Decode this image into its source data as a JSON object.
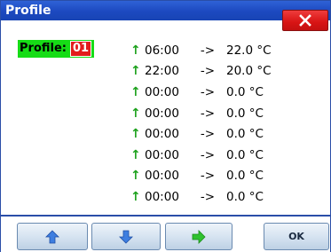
{
  "window": {
    "title": "Profile",
    "close_icon": "close-icon",
    "colors": {
      "titlebar": "#1c49c0",
      "close": "#d81414",
      "profile_bg": "#16dc16",
      "profile_num_bg": "#e21c1c",
      "arrow": "#1da11d"
    }
  },
  "profile": {
    "label": "Profile:",
    "number": "01"
  },
  "schedule": [
    {
      "icon": "↑",
      "time": "06:00",
      "sep": "->",
      "temp": "22.0 °C"
    },
    {
      "icon": "↑",
      "time": "22:00",
      "sep": "->",
      "temp": "20.0 °C"
    },
    {
      "icon": "↑",
      "time": "00:00",
      "sep": "->",
      "temp": "0.0 °C"
    },
    {
      "icon": "↑",
      "time": "00:00",
      "sep": "->",
      "temp": "0.0 °C"
    },
    {
      "icon": "↑",
      "time": "00:00",
      "sep": "->",
      "temp": "0.0 °C"
    },
    {
      "icon": "↑",
      "time": "00:00",
      "sep": "->",
      "temp": "0.0 °C"
    },
    {
      "icon": "↑",
      "time": "00:00",
      "sep": "->",
      "temp": "0.0 °C"
    },
    {
      "icon": "↑",
      "time": "00:00",
      "sep": "->",
      "temp": "0.0 °C"
    }
  ],
  "toolbar": {
    "up_icon": "arrow-up-icon",
    "down_icon": "arrow-down-icon",
    "right_icon": "arrow-right-icon",
    "ok_label": "OK"
  }
}
